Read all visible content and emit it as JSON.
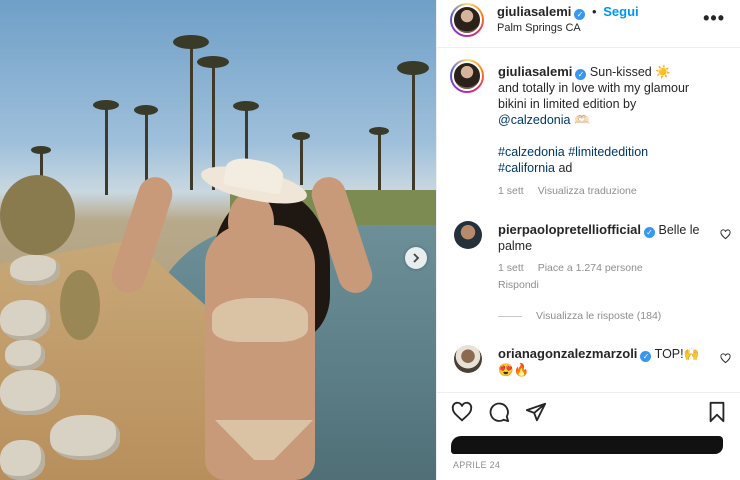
{
  "post": {
    "username": "giuliasalemi",
    "follow_label": "Segui",
    "location": "Palm Springs CA",
    "more_label": "•••"
  },
  "caption": {
    "username": "giuliasalemi",
    "line1": "Sun-kissed ☀️",
    "line2": "and totally in love with my glamour",
    "line3": "bikini in limited edition by",
    "mention": "@calzedonia",
    "mention_emoji": "🫶🏻",
    "hashtags_line1": "#calzedonia #limitededition",
    "hashtag3": "#california",
    "ad_label": "ad",
    "time": "1 sett",
    "translate_label": "Visualizza traduzione"
  },
  "comments": [
    {
      "username": "pierpaolopretelliofficial",
      "text_line1": "Belle le",
      "text_line2": "palme",
      "time": "1 sett",
      "likes": "Piace a 1.274 persone",
      "reply_label": "Rispondi",
      "view_replies": "Visualizza le risposte (184)"
    },
    {
      "username": "orianagonzalezmarzoli",
      "text_line1": "TOP!🙌",
      "text_line2": "😍🔥"
    }
  ],
  "footer": {
    "date": "APRILE 24"
  },
  "colors": {
    "accent": "#0095f6",
    "verified": "#3897f0",
    "hashtag": "#00376b",
    "muted": "#8e8e8e"
  },
  "icons": [
    "chevron-right-icon",
    "more-icon",
    "verified-icon",
    "heart-icon",
    "comment-icon",
    "share-icon",
    "bookmark-icon"
  ]
}
